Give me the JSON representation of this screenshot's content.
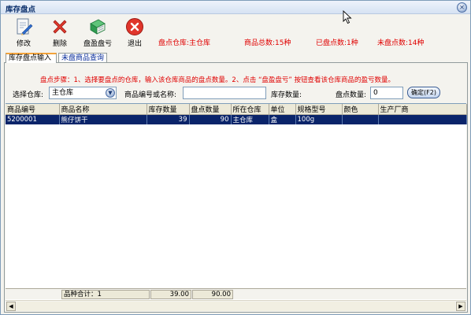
{
  "window": {
    "title": "库存盘点"
  },
  "toolbar": {
    "edit_label": "修改",
    "delete_label": "删除",
    "profit_loss_label": "盘盈盘亏",
    "exit_label": "退出"
  },
  "stats": {
    "warehouse": "盘点仓库:主仓库",
    "total": "商品总数:15种",
    "counted": "已盘点数:1种",
    "uncounted": "未盘点数:14种"
  },
  "tabs": [
    {
      "label": "库存盘点输入",
      "active": true
    },
    {
      "label": "未盘商品查询",
      "active": false
    }
  ],
  "instructions": "盘点步骤：1、选择要盘点的仓库，输入该仓库商品的盘点数量。2、点击 “盘盈盘亏” 按钮查看该仓库商品的盈亏数量。",
  "filter": {
    "warehouse_label": "选择仓库:",
    "warehouse_value": "主仓库",
    "code_label": "商品编号或名称:",
    "code_value": "",
    "stock_label": "库存数量:",
    "count_label": "盘点数量:",
    "count_value": "0",
    "confirm_label": "确定(F2)"
  },
  "table": {
    "columns": [
      "商品编号",
      "商品名称",
      "库存数量",
      "盘点数量",
      "所在仓库",
      "单位",
      "规格型号",
      "颜色",
      "生产厂商"
    ],
    "rows": [
      [
        "5200001",
        "熊仔饼干",
        "39",
        "90",
        "主仓库",
        "盒",
        "100g",
        "",
        ""
      ]
    ]
  },
  "footer": {
    "label": "品种合计：1",
    "stock_total": "39.00",
    "count_total": "90.00"
  },
  "colors": {
    "accent_red": "#e00000",
    "selection": "#0a246a"
  }
}
